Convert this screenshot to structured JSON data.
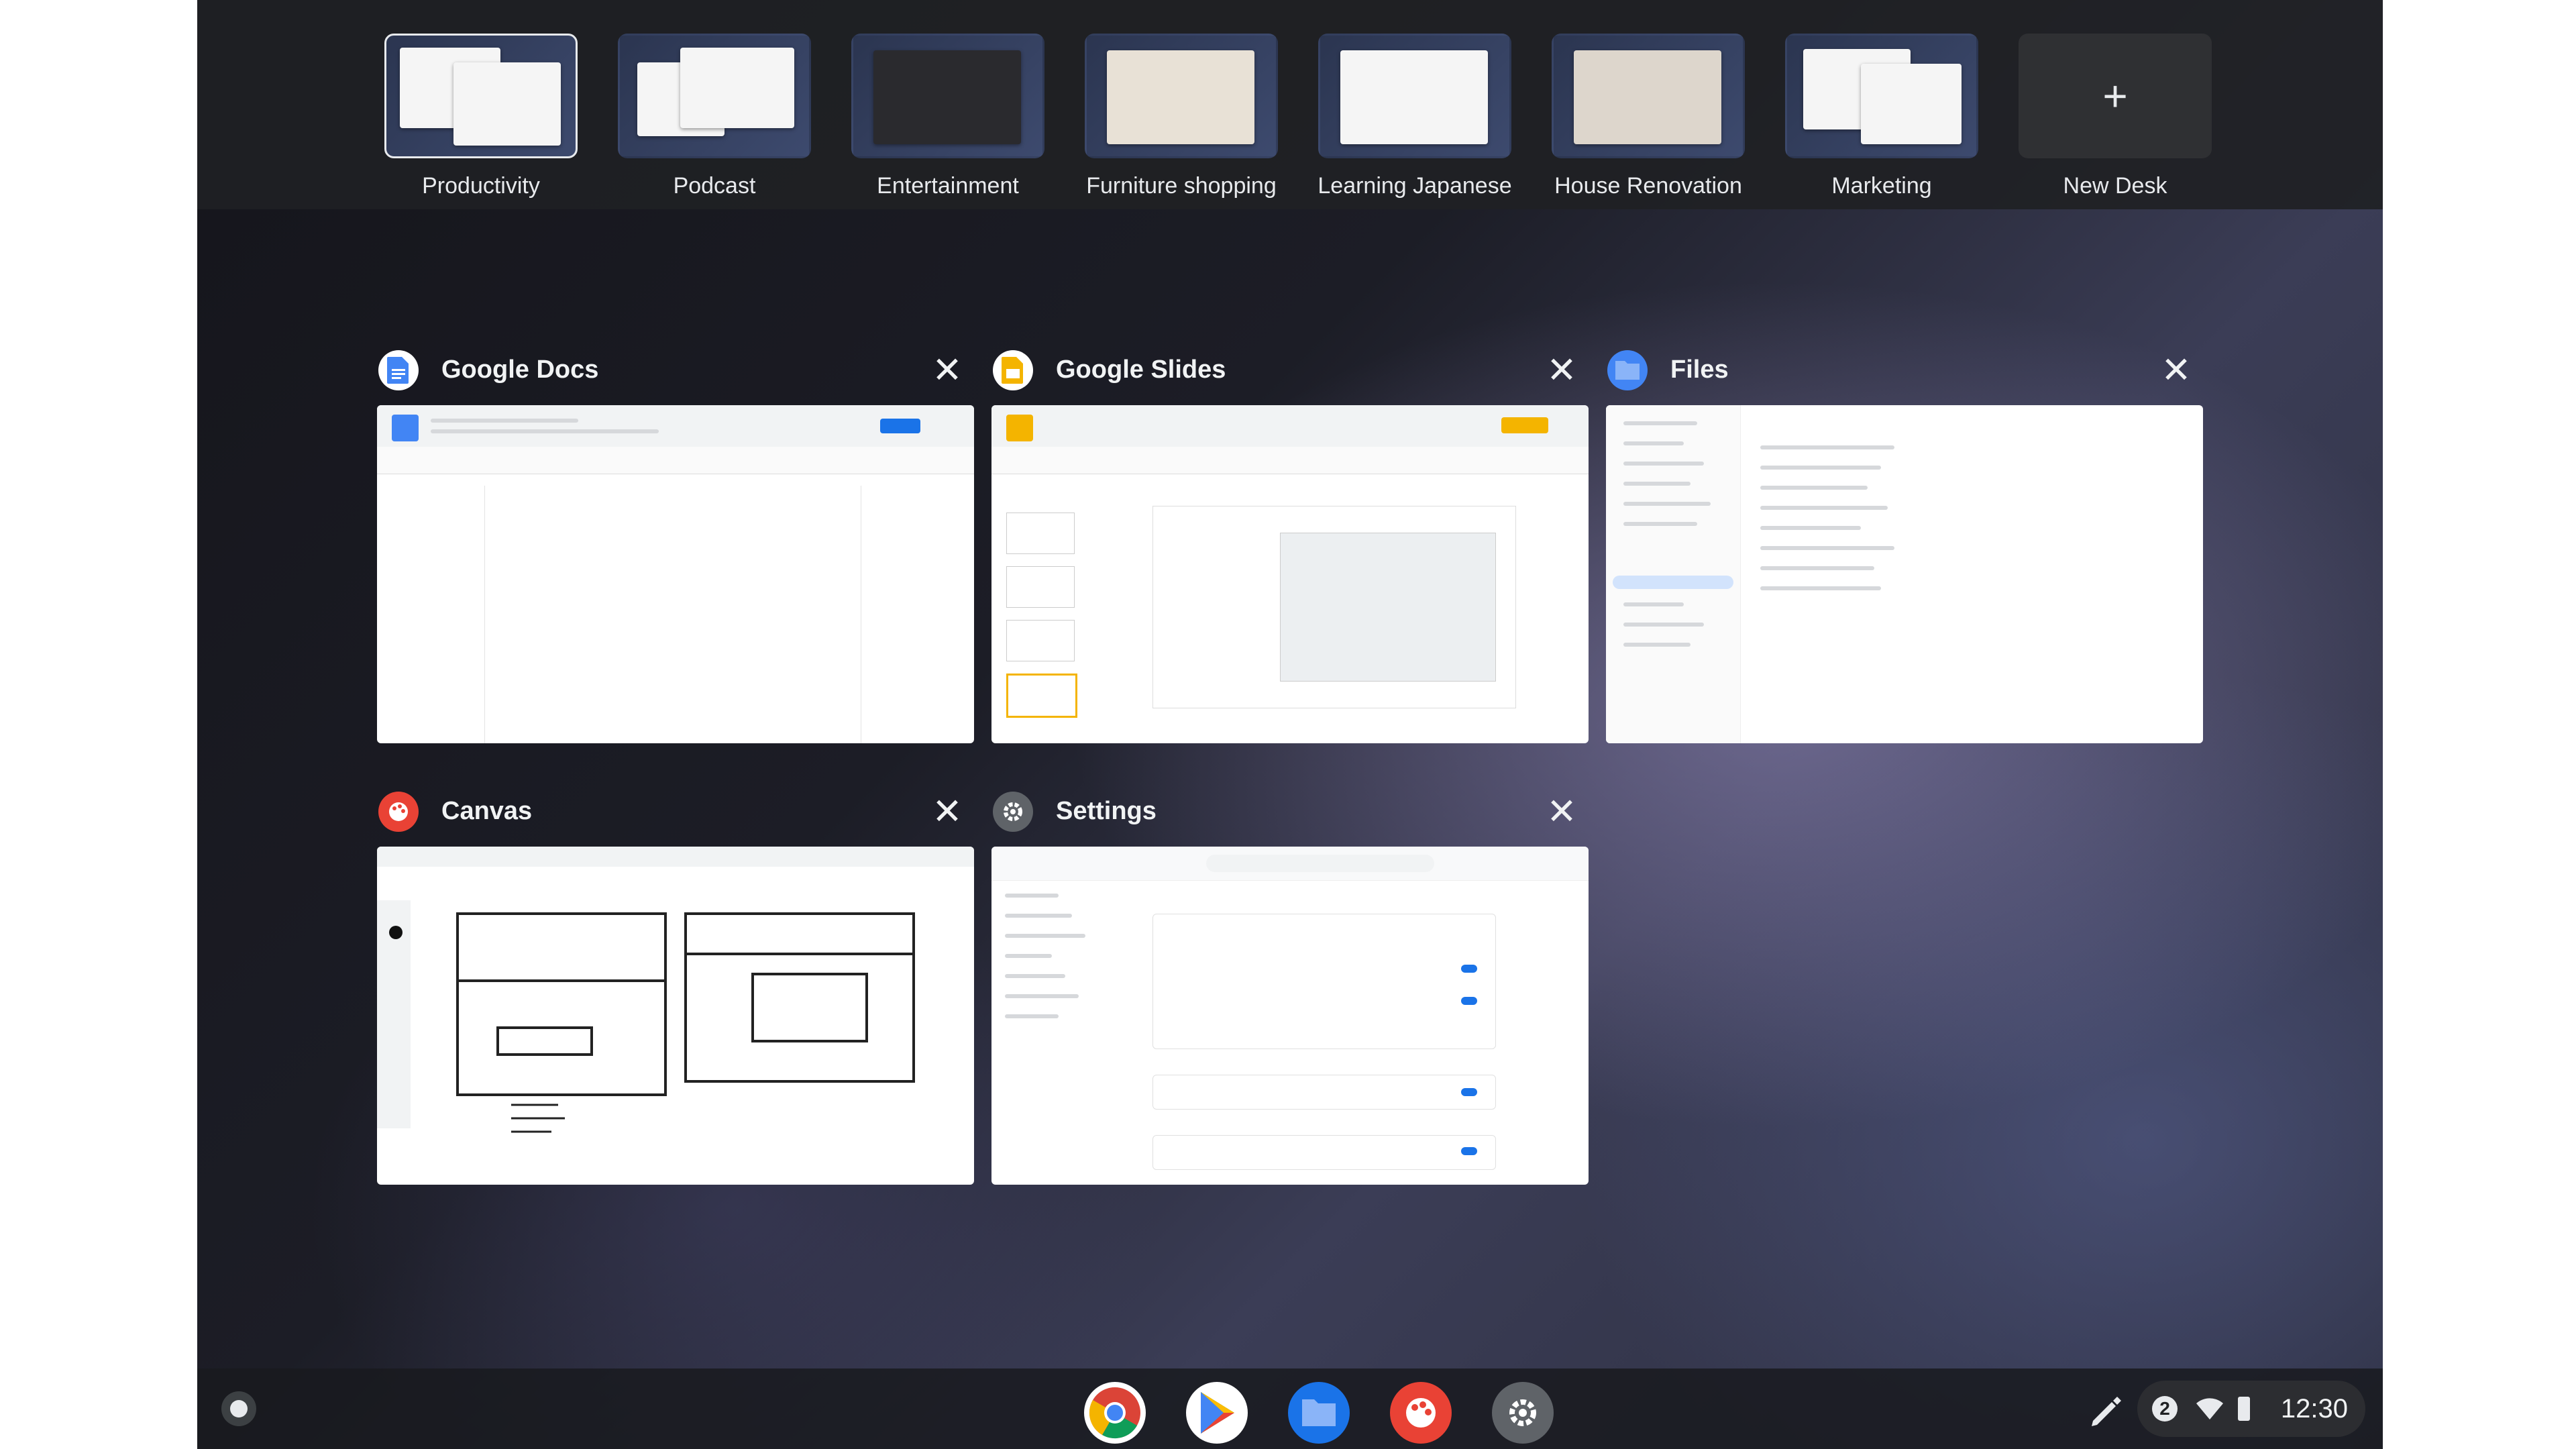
{
  "desks": [
    {
      "label": "Productivity",
      "active": true
    },
    {
      "label": "Podcast"
    },
    {
      "label": "Entertainment"
    },
    {
      "label": "Furniture shopping"
    },
    {
      "label": "Learning Japanese"
    },
    {
      "label": "House Renovation"
    },
    {
      "label": "Marketing"
    }
  ],
  "new_desk": {
    "label": "New Desk",
    "icon": "plus-icon"
  },
  "windows": [
    {
      "title": "Google Docs",
      "icon": "google-docs-icon"
    },
    {
      "title": "Google Slides",
      "icon": "google-slides-icon"
    },
    {
      "title": "Files",
      "icon": "files-icon"
    },
    {
      "title": "Canvas",
      "icon": "canvas-icon"
    },
    {
      "title": "Settings",
      "icon": "settings-icon"
    }
  ],
  "shelf": {
    "apps": [
      "chrome-icon",
      "play-store-icon",
      "files-icon",
      "canvas-icon",
      "settings-icon"
    ],
    "stylus": "stylus-icon"
  },
  "tray": {
    "notification_count": "2",
    "time": "12:30"
  },
  "colors": {
    "desk_bar": "#202124",
    "card_title": "#f1f3f4",
    "docs_blue": "#4285f4",
    "slides_yellow": "#f4b400",
    "canvas_red": "#e94235"
  }
}
